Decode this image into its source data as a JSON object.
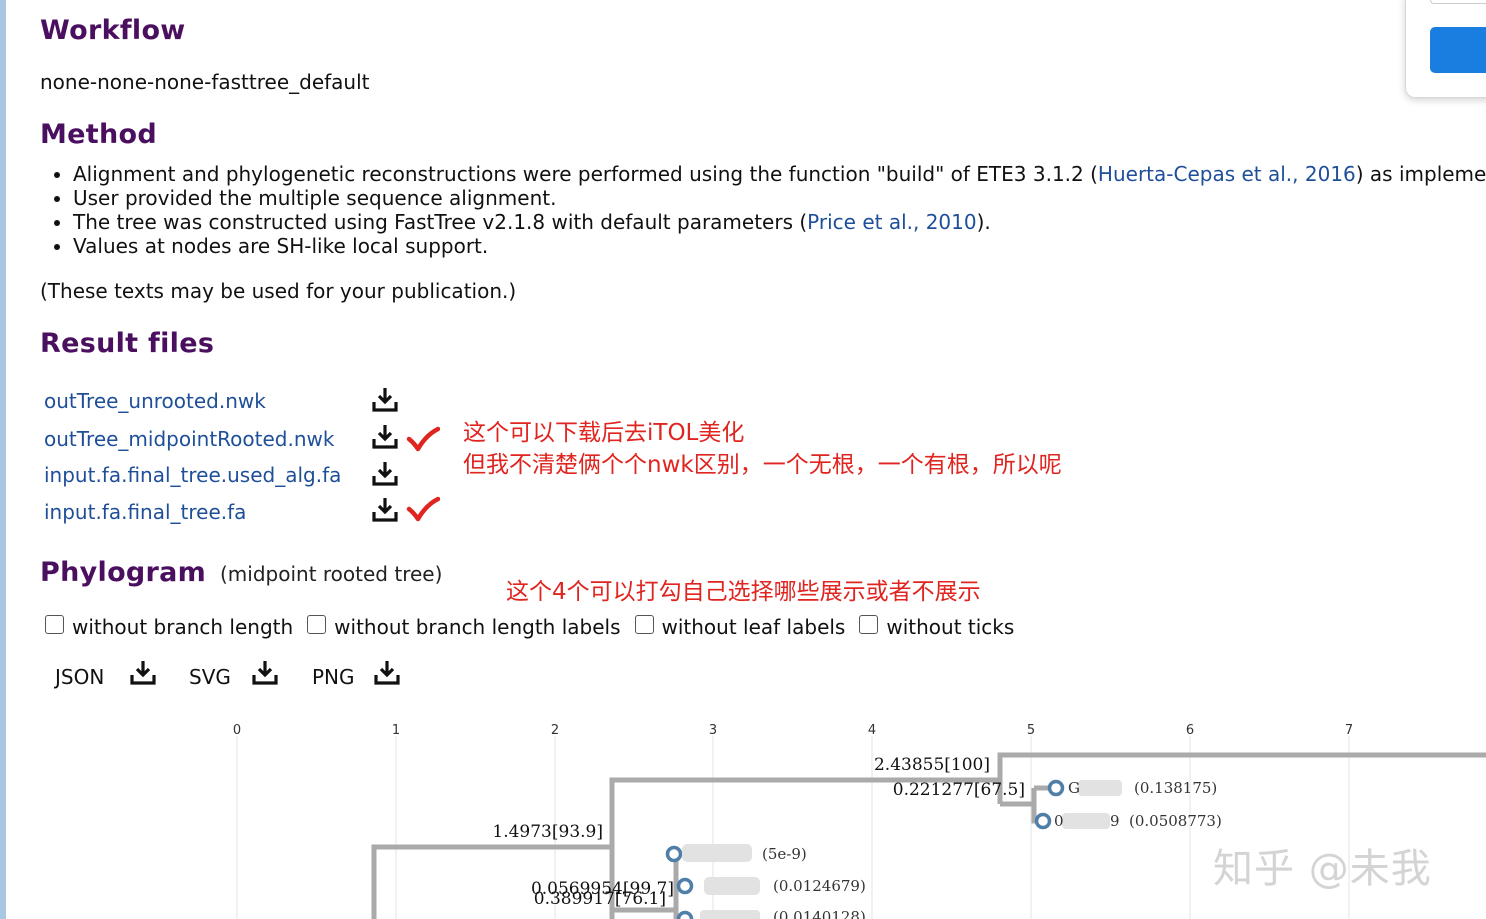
{
  "workflow": {
    "heading": "Workflow",
    "value": "none-none-none-fasttree_default"
  },
  "method": {
    "heading": "Method",
    "items": [
      {
        "before": "Alignment and phylogenetic reconstructions were performed using the function \"build\" of ETE3 3.1.2 (",
        "link": "Huerta-Cepas et al., 2016",
        "after": ") as implemented"
      },
      {
        "before": "User provided the multiple sequence alignment.",
        "link": "",
        "after": ""
      },
      {
        "before": "The tree was constructed using FastTree v2.1.8 with default parameters (",
        "link": "Price et al., 2010",
        "after": ")."
      },
      {
        "before": "Values at nodes are SH-like local support.",
        "link": "",
        "after": ""
      }
    ],
    "note": "(These texts may be used for your publication.)"
  },
  "result_files": {
    "heading": "Result files",
    "files": [
      {
        "name": "outTree_unrooted.nwk",
        "checked": false
      },
      {
        "name": "outTree_midpointRooted.nwk",
        "checked": true
      },
      {
        "name": "input.fa.final_tree.used_alg.fa",
        "checked": false
      },
      {
        "name": "input.fa.final_tree.fa",
        "checked": true
      }
    ],
    "annotation_line1": "这个可以下载后去iTOL美化",
    "annotation_line2": "但我不清楚俩个个nwk区别，一个无根，一个有根，所以呢"
  },
  "phylogram": {
    "heading": "Phylogram",
    "subtitle": "(midpoint rooted tree)",
    "annotation": "这个4个可以打勾自己选择哪些展示或者不展示",
    "options": [
      {
        "label": "without branch length",
        "checked": false
      },
      {
        "label": "without branch length labels",
        "checked": false
      },
      {
        "label": "without leaf labels",
        "checked": false
      },
      {
        "label": "without ticks",
        "checked": false
      }
    ],
    "exports": [
      "JSON",
      "SVG",
      "PNG"
    ],
    "axis_ticks": [
      "0",
      "1",
      "2",
      "3",
      "4",
      "5",
      "6",
      "7"
    ],
    "branch_labels": [
      "2.43855[100]",
      "0.221277[67.5]",
      "1.4973[93.9]",
      "0.0569954[99.7]",
      "0.389917[76.1]"
    ],
    "leaf_labels": [
      "G",
      "(0.138175)",
      "0",
      "9",
      "(0.0508773)",
      "(5e-9)",
      "(0.0124679)",
      "(0.0140128)"
    ],
    "colors": {
      "branch": "#aaaaaa",
      "node": "#4f7fa8",
      "grid": "#e3e3e3"
    }
  },
  "watermark": "知乎 @未我",
  "icons": {
    "download": "download-icon",
    "check": "red-check-icon"
  }
}
